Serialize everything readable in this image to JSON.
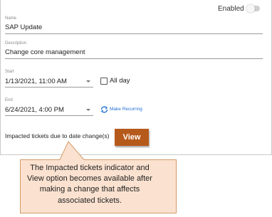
{
  "header": {
    "enabled_label": "Enabled",
    "enabled": false
  },
  "name": {
    "caption": "Name",
    "value": "SAP Update"
  },
  "description": {
    "caption": "Description",
    "value": "Change core management"
  },
  "start": {
    "caption": "Start",
    "value": "1/13/2021, 11:00 AM"
  },
  "all_day": {
    "label": "All day",
    "checked": false
  },
  "end": {
    "caption": "End",
    "value": "6/24/2021, 4:00 PM"
  },
  "recurring": {
    "label": "Make Recurring"
  },
  "impacted": {
    "label": "Impacted tickets due to date change(s)",
    "button": "View"
  },
  "callout": {
    "text": "The Impacted tickets indicator  and View option becomes available after making a change that affects associated tickets."
  },
  "colors": {
    "button": "#b65a1c",
    "callout_fill": "#fbe2d0",
    "callout_border": "#d39a6a",
    "link": "#1f6fd1"
  }
}
